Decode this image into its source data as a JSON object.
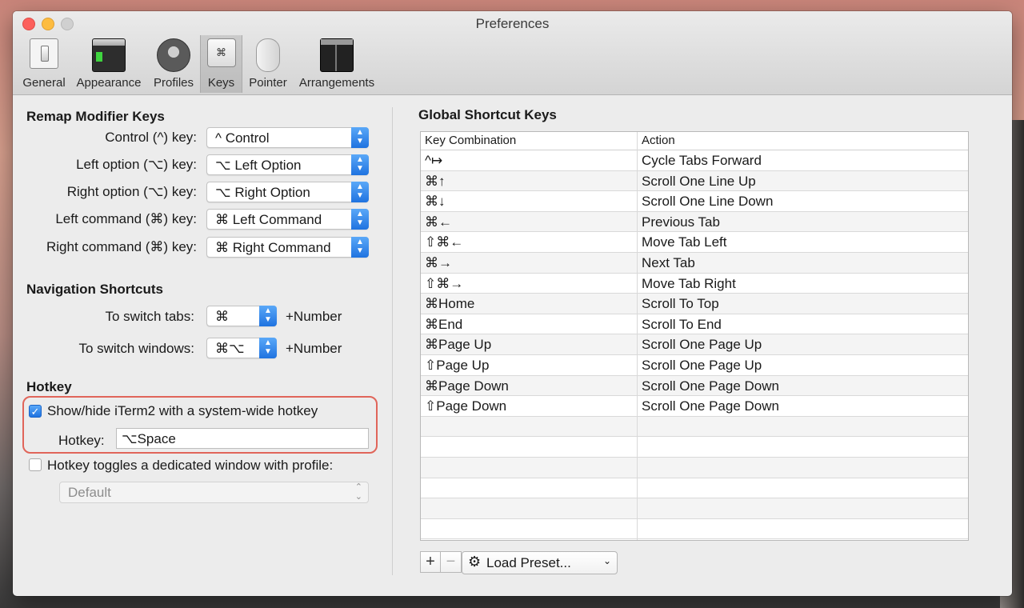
{
  "window": {
    "title": "Preferences"
  },
  "toolbar": [
    {
      "label": "General",
      "icon": "general-switch-icon"
    },
    {
      "label": "Appearance",
      "icon": "appearance-icon"
    },
    {
      "label": "Profiles",
      "icon": "profiles-icon"
    },
    {
      "label": "Keys",
      "icon": "keys-icon",
      "active": true,
      "glyph": "⌘"
    },
    {
      "label": "Pointer",
      "icon": "pointer-mouse-icon"
    },
    {
      "label": "Arrangements",
      "icon": "arrangements-icon"
    }
  ],
  "remap": {
    "title": "Remap Modifier Keys",
    "rows": [
      {
        "label": "Control (^) key:",
        "value": "^ Control"
      },
      {
        "label": "Left option (⌥) key:",
        "value": "⌥ Left Option"
      },
      {
        "label": "Right option (⌥) key:",
        "value": "⌥ Right Option"
      },
      {
        "label": "Left command (⌘) key:",
        "value": "⌘ Left Command"
      },
      {
        "label": "Right command (⌘) key:",
        "value": "⌘ Right Command"
      }
    ]
  },
  "navigation": {
    "title": "Navigation Shortcuts",
    "switch_tabs_label": "To switch tabs:",
    "switch_tabs_value": "⌘",
    "switch_windows_label": "To switch windows:",
    "switch_windows_value": "⌘⌥",
    "suffix": "+Number"
  },
  "hotkey": {
    "title": "Hotkey",
    "show_hide_label": "Show/hide iTerm2 with a system-wide hotkey",
    "show_hide_checked": true,
    "hotkey_label": "Hotkey:",
    "hotkey_value": "⌥Space",
    "toggle_label": "Hotkey toggles a dedicated window with profile:",
    "toggle_checked": false,
    "profile_value": "Default"
  },
  "global": {
    "title": "Global Shortcut Keys",
    "columns": [
      "Key Combination",
      "Action"
    ],
    "rows": [
      {
        "key": "^↦",
        "action": "Cycle Tabs Forward"
      },
      {
        "key": "⌘↑",
        "action": "Scroll One Line Up"
      },
      {
        "key": "⌘↓",
        "action": "Scroll One Line Down"
      },
      {
        "key": "⌘←",
        "action": "Previous Tab"
      },
      {
        "key": "⇧⌘←",
        "action": "Move Tab Left"
      },
      {
        "key": "⌘→",
        "action": "Next Tab"
      },
      {
        "key": "⇧⌘→",
        "action": "Move Tab Right"
      },
      {
        "key": "⌘Home",
        "action": "Scroll To Top"
      },
      {
        "key": "⌘End",
        "action": "Scroll To End"
      },
      {
        "key": "⌘Page Up",
        "action": "Scroll One Page Up"
      },
      {
        "key": "⇧Page Up",
        "action": "Scroll One Page Up"
      },
      {
        "key": "⌘Page Down",
        "action": "Scroll One Page Down"
      },
      {
        "key": "⇧Page Down",
        "action": "Scroll One Page Down"
      }
    ],
    "add_label": "+",
    "remove_label": "−",
    "load_preset_label": "Load Preset...",
    "gear_glyph": "⚙",
    "chevron_glyph": "⌄"
  },
  "colors": {
    "accent": "#1f73e0",
    "highlight": "#e0655a"
  }
}
